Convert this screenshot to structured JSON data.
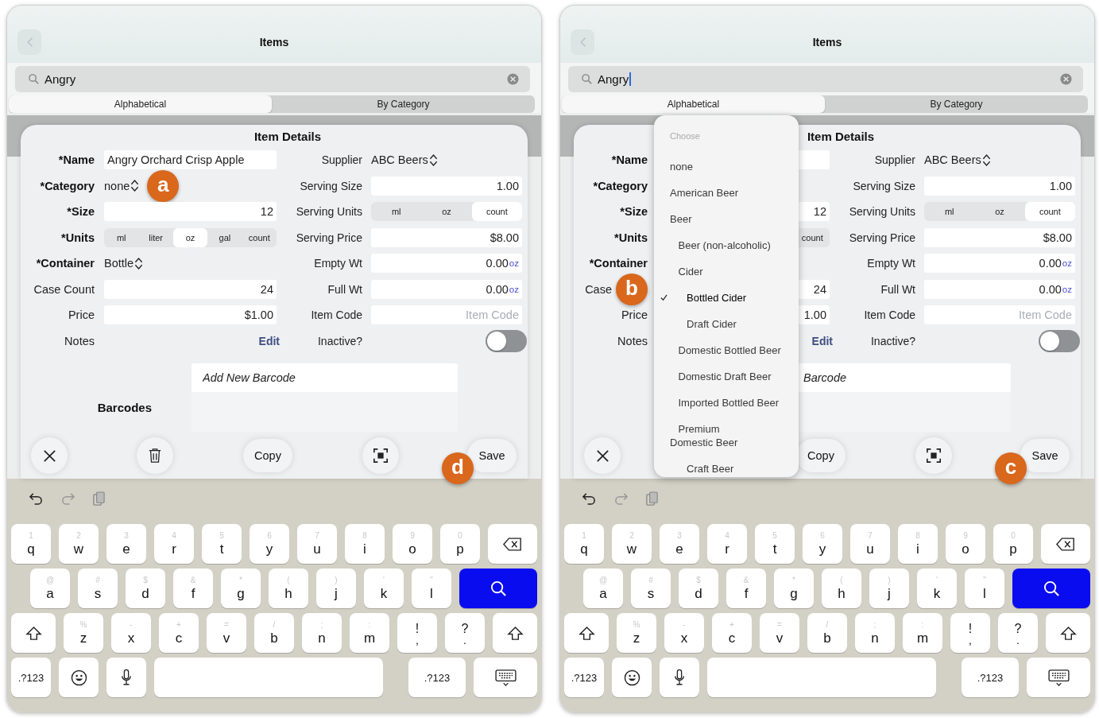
{
  "screens": [
    {
      "nav": {
        "title": "Items"
      },
      "search": {
        "value": "Angry",
        "focused": false
      },
      "segments": [
        {
          "label": "Alphabetical",
          "selected": true
        },
        {
          "label": "By Category",
          "selected": false
        }
      ],
      "dialog": {
        "title": "Item Details",
        "left_fields": [
          {
            "label": "*Name",
            "required": true,
            "kind": "text",
            "value": "Angry Orchard Crisp Apple"
          },
          {
            "label": "*Category",
            "required": true,
            "kind": "picker",
            "value": "none",
            "callout": {
              "letter": "a"
            }
          },
          {
            "label": "*Size",
            "required": true,
            "kind": "number",
            "value": "12"
          },
          {
            "label": "*Units",
            "required": true,
            "kind": "segmented",
            "options": [
              {
                "label": "ml",
                "selected": false
              },
              {
                "label": "liter",
                "selected": false
              },
              {
                "label": "oz",
                "selected": true
              },
              {
                "label": "gal",
                "selected": false
              },
              {
                "label": "count",
                "selected": false
              }
            ]
          },
          {
            "label": "*Container",
            "required": true,
            "kind": "picker",
            "value": "Bottle"
          },
          {
            "label": "Case Count",
            "required": false,
            "kind": "number",
            "value": "24"
          },
          {
            "label": "Price",
            "required": false,
            "kind": "number",
            "value": "$1.00"
          },
          {
            "label": "Notes",
            "required": false,
            "kind": "link",
            "value": "Edit"
          }
        ],
        "right_fields": [
          {
            "label": "Supplier",
            "required": false,
            "kind": "picker",
            "value": "ABC Beers"
          },
          {
            "label": "Serving Size",
            "required": false,
            "kind": "number",
            "value": "1.00"
          },
          {
            "label": "Serving Units",
            "required": false,
            "kind": "segmented",
            "options": [
              {
                "label": "ml",
                "selected": false
              },
              {
                "label": "oz",
                "selected": false
              },
              {
                "label": "count",
                "selected": true
              }
            ]
          },
          {
            "label": "Serving Price",
            "required": false,
            "kind": "number",
            "value": "$8.00"
          },
          {
            "label": "Empty Wt",
            "required": false,
            "kind": "number",
            "value": "0.00",
            "unit": "oz"
          },
          {
            "label": "Full Wt",
            "required": false,
            "kind": "number",
            "value": "0.00",
            "unit": "oz"
          },
          {
            "label": "Item Code",
            "required": false,
            "kind": "number",
            "placeholder": "Item Code"
          },
          {
            "label": "Inactive?",
            "required": false,
            "kind": "toggle",
            "on": false
          }
        ],
        "barcodes": {
          "label": "Barcodes",
          "placeholder": "Add New Barcode"
        },
        "actions": [
          {
            "kind": "close"
          },
          {
            "kind": "delete"
          },
          {
            "kind": "copy",
            "label": "Copy"
          },
          {
            "kind": "scan"
          },
          {
            "kind": "save",
            "label": "Save",
            "callout": {
              "letter": "d"
            }
          }
        ]
      },
      "keyboard": {
        "rows": [
          [
            {
              "kind": "letter",
              "label": "q",
              "hint": "1"
            },
            {
              "kind": "letter",
              "label": "w",
              "hint": "2"
            },
            {
              "kind": "letter",
              "label": "e",
              "hint": "3"
            },
            {
              "kind": "letter",
              "label": "r",
              "hint": "4"
            },
            {
              "kind": "letter",
              "label": "t",
              "hint": "5"
            },
            {
              "kind": "letter",
              "label": "y",
              "hint": "6"
            },
            {
              "kind": "letter",
              "label": "u",
              "hint": "7"
            },
            {
              "kind": "letter",
              "label": "i",
              "hint": "8"
            },
            {
              "kind": "letter",
              "label": "o",
              "hint": "9"
            },
            {
              "kind": "letter",
              "label": "p",
              "hint": "0"
            },
            {
              "kind": "backspace"
            }
          ],
          [
            {
              "kind": "letter",
              "label": "a",
              "hint": "@"
            },
            {
              "kind": "letter",
              "label": "s",
              "hint": "#"
            },
            {
              "kind": "letter",
              "label": "d",
              "hint": "$"
            },
            {
              "kind": "letter",
              "label": "f",
              "hint": "&"
            },
            {
              "kind": "letter",
              "label": "g",
              "hint": "*"
            },
            {
              "kind": "letter",
              "label": "h",
              "hint": "("
            },
            {
              "kind": "letter",
              "label": "j",
              "hint": ")"
            },
            {
              "kind": "letter",
              "label": "k",
              "hint": "'"
            },
            {
              "kind": "letter",
              "label": "l",
              "hint": "\""
            },
            {
              "kind": "search"
            }
          ],
          [
            {
              "kind": "shift"
            },
            {
              "kind": "letter",
              "label": "z",
              "hint": "%"
            },
            {
              "kind": "letter",
              "label": "x",
              "hint": "-"
            },
            {
              "kind": "letter",
              "label": "c",
              "hint": "+"
            },
            {
              "kind": "letter",
              "label": "v",
              "hint": "="
            },
            {
              "kind": "letter",
              "label": "b",
              "hint": "/"
            },
            {
              "kind": "letter",
              "label": "n",
              "hint": ";"
            },
            {
              "kind": "letter",
              "label": "m",
              "hint": ":"
            },
            {
              "kind": "punct",
              "label": ",",
              "hint": "!"
            },
            {
              "kind": "punct",
              "label": ".",
              "hint": "?"
            },
            {
              "kind": "shift"
            }
          ],
          [
            {
              "kind": "numbers",
              "label": ".?123",
              "wide": false
            },
            {
              "kind": "emoji"
            },
            {
              "kind": "mic"
            },
            {
              "kind": "space"
            },
            {
              "kind": "numbers",
              "label": ".?123",
              "wide": true
            },
            {
              "kind": "hide"
            }
          ]
        ]
      }
    },
    {
      "nav": {
        "title": "Items"
      },
      "search": {
        "value": "Angry",
        "focused": true
      },
      "segments": [
        {
          "label": "Alphabetical",
          "selected": true
        },
        {
          "label": "By Category",
          "selected": false
        }
      ],
      "dialog": {
        "title": "Item Details",
        "left_fields": [
          {
            "label": "*Name",
            "required": true,
            "kind": "text"
          },
          {
            "label": "*Category",
            "required": true,
            "kind": "picker"
          },
          {
            "label": "*Size",
            "required": true,
            "kind": "number",
            "value": "12"
          },
          {
            "label": "*Units",
            "required": true,
            "kind": "segmented",
            "options": [
              {
                "label": "count",
                "selected": false
              }
            ]
          },
          {
            "label": "*Container",
            "required": true,
            "kind": "picker"
          },
          {
            "label": "Case",
            "required": false,
            "kind": "number",
            "value": "24",
            "callout": {
              "letter": "b"
            }
          },
          {
            "label": "Price",
            "required": false,
            "kind": "number",
            "value": "1.00"
          },
          {
            "label": "Notes",
            "required": false,
            "kind": "link",
            "value": "Edit"
          }
        ],
        "right_fields": [
          {
            "label": "Supplier",
            "required": false,
            "kind": "picker",
            "value": "ABC Beers"
          },
          {
            "label": "Serving Size",
            "required": false,
            "kind": "number",
            "value": "1.00"
          },
          {
            "label": "Serving Units",
            "required": false,
            "kind": "segmented",
            "options": [
              {
                "label": "ml",
                "selected": false
              },
              {
                "label": "oz",
                "selected": false
              },
              {
                "label": "count",
                "selected": true
              }
            ]
          },
          {
            "label": "Serving Price",
            "required": false,
            "kind": "number",
            "value": "$8.00"
          },
          {
            "label": "Empty Wt",
            "required": false,
            "kind": "number",
            "value": "0.00",
            "unit": "oz"
          },
          {
            "label": "Full Wt",
            "required": false,
            "kind": "number",
            "value": "0.00",
            "unit": "oz"
          },
          {
            "label": "Item Code",
            "required": false,
            "kind": "number",
            "placeholder": "Item Code"
          },
          {
            "label": "Inactive?",
            "required": false,
            "kind": "toggle",
            "on": false
          }
        ],
        "barcodes": {
          "placeholder": "Barcode"
        },
        "actions": [
          {
            "kind": "close"
          },
          {
            "kind": "copy",
            "label": "Copy"
          },
          {
            "kind": "scan"
          },
          {
            "kind": "save",
            "label": "Save",
            "callout": {
              "letter": "c"
            }
          }
        ]
      },
      "dropdown": {
        "header": "Choose",
        "items": [
          {
            "label": "none",
            "selected": false
          },
          {
            "label": "American Beer",
            "selected": false
          },
          {
            "label": "Beer",
            "selected": false,
            "children": [
              {
                "label": "Beer (non-alcoholic)",
                "selected": false
              },
              {
                "label": "Cider",
                "selected": false,
                "children": [
                  {
                    "label": "Bottled Cider",
                    "selected": true
                  },
                  {
                    "label": "Draft Cider",
                    "selected": false
                  }
                ]
              },
              {
                "label": "Domestic Bottled Beer",
                "selected": false
              },
              {
                "label": "Domestic Draft Beer",
                "selected": false
              },
              {
                "label": "Imported Bottled Beer",
                "selected": false
              },
              {
                "label": "Premium\nDomestic Beer",
                "selected": false,
                "children": [
                  {
                    "label": "Craft Beer",
                    "selected": false
                  }
                ]
              }
            ]
          }
        ]
      },
      "keyboard": {
        "rows": [
          [
            {
              "kind": "letter",
              "label": "q",
              "hint": "1"
            },
            {
              "kind": "letter",
              "label": "w",
              "hint": "2"
            },
            {
              "kind": "letter",
              "label": "e",
              "hint": "3"
            },
            {
              "kind": "letter",
              "label": "r",
              "hint": "4"
            },
            {
              "kind": "letter",
              "label": "t",
              "hint": "5"
            },
            {
              "kind": "letter",
              "label": "y",
              "hint": "6"
            },
            {
              "kind": "letter",
              "label": "u",
              "hint": "7"
            },
            {
              "kind": "letter",
              "label": "i",
              "hint": "8"
            },
            {
              "kind": "letter",
              "label": "o",
              "hint": "9"
            },
            {
              "kind": "letter",
              "label": "p",
              "hint": "0"
            },
            {
              "kind": "backspace"
            }
          ],
          [
            {
              "kind": "letter",
              "label": "a",
              "hint": "@"
            },
            {
              "kind": "letter",
              "label": "s",
              "hint": "#"
            },
            {
              "kind": "letter",
              "label": "d",
              "hint": "$"
            },
            {
              "kind": "letter",
              "label": "f",
              "hint": "&"
            },
            {
              "kind": "letter",
              "label": "g",
              "hint": "*"
            },
            {
              "kind": "letter",
              "label": "h",
              "hint": "("
            },
            {
              "kind": "letter",
              "label": "j",
              "hint": ")"
            },
            {
              "kind": "letter",
              "label": "k",
              "hint": "'"
            },
            {
              "kind": "letter",
              "label": "l",
              "hint": "\""
            },
            {
              "kind": "search"
            }
          ],
          [
            {
              "kind": "shift"
            },
            {
              "kind": "letter",
              "label": "z",
              "hint": "%"
            },
            {
              "kind": "letter",
              "label": "x",
              "hint": "-"
            },
            {
              "kind": "letter",
              "label": "c",
              "hint": "+"
            },
            {
              "kind": "letter",
              "label": "v",
              "hint": "="
            },
            {
              "kind": "letter",
              "label": "b",
              "hint": "/"
            },
            {
              "kind": "letter",
              "label": "n",
              "hint": ";"
            },
            {
              "kind": "letter",
              "label": "m",
              "hint": ":"
            },
            {
              "kind": "punct",
              "label": ",",
              "hint": "!"
            },
            {
              "kind": "punct",
              "label": ".",
              "hint": "?"
            },
            {
              "kind": "shift"
            }
          ],
          [
            {
              "kind": "numbers",
              "label": ".?123",
              "wide": false
            },
            {
              "kind": "emoji"
            },
            {
              "kind": "mic"
            },
            {
              "kind": "space"
            },
            {
              "kind": "numbers",
              "label": ".?123",
              "wide": true
            },
            {
              "kind": "hide"
            }
          ]
        ]
      }
    }
  ]
}
